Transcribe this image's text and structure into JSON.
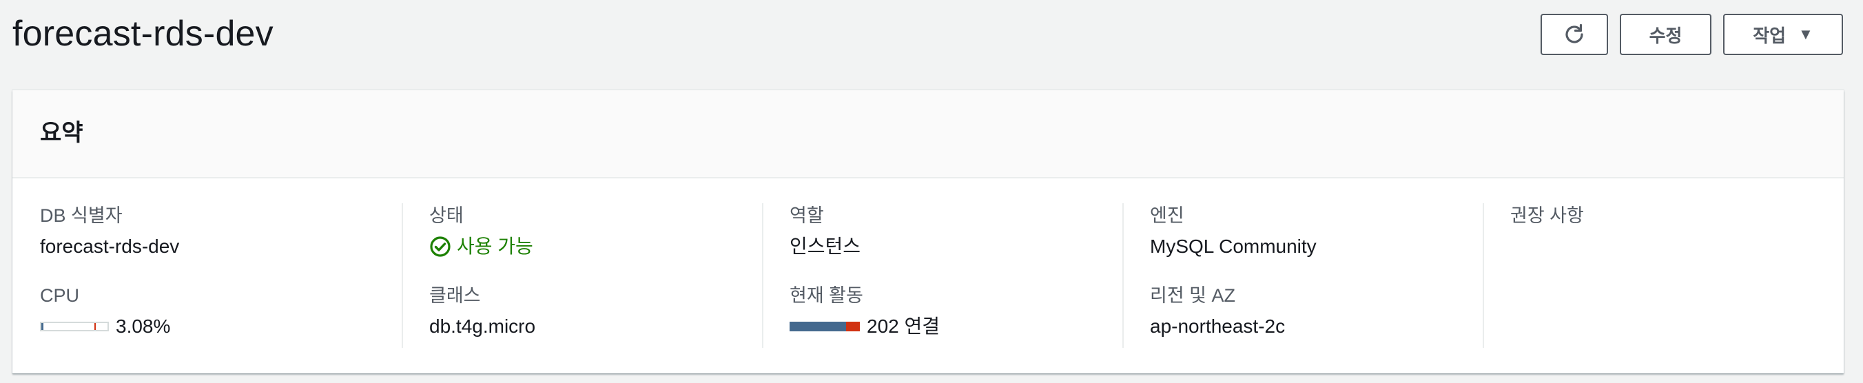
{
  "header": {
    "title": "forecast-rds-dev",
    "buttons": {
      "refresh_icon": "refresh-icon",
      "edit_label": "수정",
      "actions_label": "작업",
      "actions_caret": "▼"
    }
  },
  "summary": {
    "title": "요약",
    "db_identifier": {
      "label": "DB 식별자",
      "value": "forecast-rds-dev"
    },
    "cpu": {
      "label": "CPU",
      "value_text": "3.08%",
      "percent": 3.08
    },
    "status": {
      "label": "상태",
      "value": "사용 가능",
      "color": "#1d8102"
    },
    "class": {
      "label": "클래스",
      "value": "db.t4g.micro"
    },
    "role": {
      "label": "역할",
      "value": "인스턴스"
    },
    "activity": {
      "label": "현재 활동",
      "value_text": "202 연결",
      "connections": 202
    },
    "engine": {
      "label": "엔진",
      "value": "MySQL Community"
    },
    "region_az": {
      "label": "리전 및 AZ",
      "value": "ap-northeast-2c"
    },
    "recommendations": {
      "label": "권장 사항"
    }
  },
  "colors": {
    "meter_fill": "#44698e",
    "meter_alert": "#d13212",
    "success": "#1d8102"
  }
}
